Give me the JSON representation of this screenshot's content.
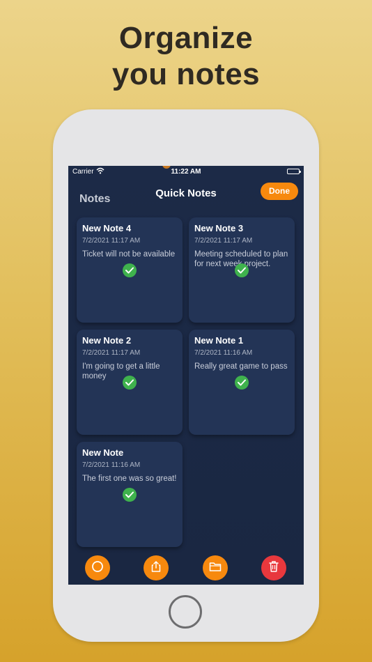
{
  "headline": {
    "line1": "Organize",
    "line2": "you notes"
  },
  "status_bar": {
    "carrier": "Carrier",
    "time": "11:22 AM"
  },
  "nav": {
    "left_label": "Notes",
    "title": "Quick Notes",
    "done_label": "Done"
  },
  "notes": [
    {
      "title": "New Note 4",
      "date": "7/2/2021 11:17 AM",
      "body": "Ticket will not be available",
      "completed": true
    },
    {
      "title": "New Note 3",
      "date": "7/2/2021 11:17 AM",
      "body": "Meeting scheduled to plan for next week project.",
      "completed": true
    },
    {
      "title": "New Note 2",
      "date": "7/2/2021 11:17 AM",
      "body": "I'm going to get a little money",
      "completed": true
    },
    {
      "title": "New Note 1",
      "date": "7/2/2021 11:16 AM",
      "body": "Really great game to pass",
      "completed": true
    },
    {
      "title": "New Note",
      "date": "7/2/2021 11:16 AM",
      "body": "The first one was so great!",
      "completed": true
    }
  ],
  "toolbar": [
    {
      "icon": "circle-icon",
      "color": "#f7890e"
    },
    {
      "icon": "share-icon",
      "color": "#f7890e"
    },
    {
      "icon": "folder-icon",
      "color": "#f7890e"
    },
    {
      "icon": "trash-icon",
      "color": "#e8383d"
    }
  ],
  "colors": {
    "accent": "#f7890e",
    "danger": "#e8383d",
    "check": "#3fb24d",
    "screen_bg": "#1c2a47",
    "card_bg": "#233456"
  }
}
